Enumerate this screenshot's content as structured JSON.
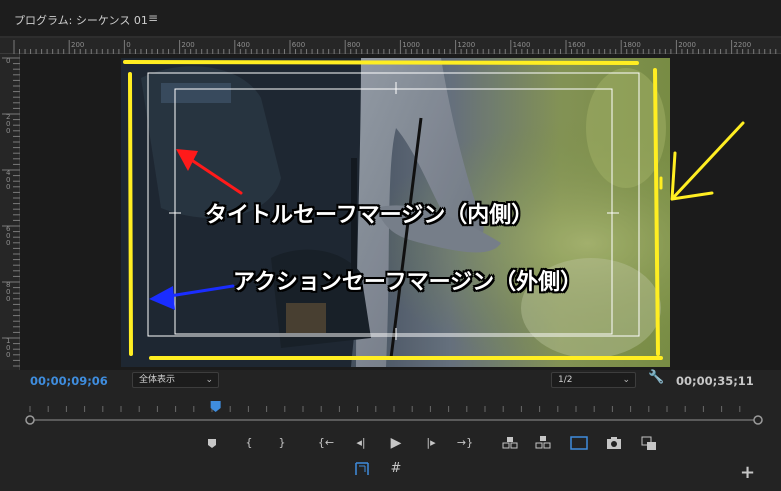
{
  "header": {
    "title": "プログラム: シーケンス 01",
    "menu_icon": "hamburger-menu-icon"
  },
  "ruler": {
    "top_labels": [
      "200",
      "0",
      "200",
      "400",
      "600",
      "800",
      "1000",
      "1200",
      "1400",
      "1600",
      "1800",
      "2000",
      "2200"
    ],
    "left_labels": [
      "0",
      "2\n0\n0",
      "4\n0\n0",
      "6\n0\n0",
      "8\n0\n0",
      "1\n0\n0"
    ]
  },
  "annotations": {
    "title_safe": "タイトルセーフマージン（内側）",
    "action_safe": "アクションセーフマージン（外側）",
    "colors": {
      "yellow": "#ffee22",
      "red": "#ff1a1a",
      "blue": "#1a2dff"
    }
  },
  "timecode": {
    "current": "00;00;09;06",
    "total": "00;00;35;11"
  },
  "zoom_select": {
    "value": "全体表示"
  },
  "resolution_select": {
    "value": "1/2"
  },
  "playhead_fraction": 0.255,
  "transport": {
    "buttons": [
      "add-marker-icon",
      "mark-in-icon",
      "mark-out-icon",
      "go-to-in-icon",
      "step-back-icon",
      "play-icon",
      "step-forward-icon",
      "go-to-out-icon",
      "lift-icon",
      "extract-icon",
      "safe-margins-icon",
      "export-frame-icon",
      "compare-view-icon"
    ],
    "row2": [
      "safe-margin-toggle-icon",
      "grid-icon"
    ],
    "add_button": "+"
  },
  "accent_color": "#3f8dde"
}
